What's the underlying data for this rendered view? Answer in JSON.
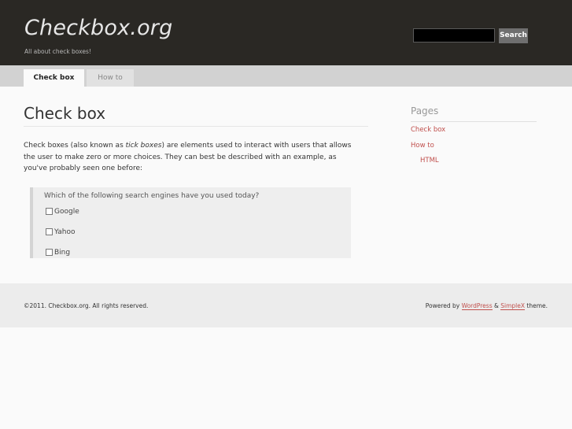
{
  "header": {
    "site_title": "Checkbox.org",
    "tagline": "All about check boxes!",
    "search_placeholder": "",
    "search_button": "Search"
  },
  "nav": {
    "tabs": [
      {
        "label": "Check box",
        "active": true
      },
      {
        "label": "How to",
        "active": false
      }
    ]
  },
  "main": {
    "title": "Check box",
    "intro_part1": "Check boxes (also known as ",
    "intro_emphasis": "tick boxes",
    "intro_part2": ") are elements used to interact with users that allows the user to make zero or more choices. They can best be described with an example, as you've probably seen one before:",
    "poll": {
      "question": "Which of the following search engines have you used today?",
      "options": [
        {
          "label": "Google",
          "checked": false
        },
        {
          "label": "Yahoo",
          "checked": false
        },
        {
          "label": "Bing",
          "checked": false
        }
      ]
    }
  },
  "sidebar": {
    "title": "Pages",
    "links": [
      {
        "label": "Check box"
      },
      {
        "label": "How to"
      },
      {
        "label": "HTML"
      }
    ]
  },
  "footer": {
    "copyright": "©2011. Checkbox.org. All rights reserved.",
    "powered_prefix": "Powered by ",
    "wordpress": "WordPress",
    "amp": " & ",
    "simplex": "SimpleX",
    "theme_suffix": " theme."
  },
  "colors": {
    "header_bg": "#2a2824",
    "link": "#c0504d",
    "nav_bg": "#d2d2d2",
    "footer_bg": "#ececec"
  }
}
